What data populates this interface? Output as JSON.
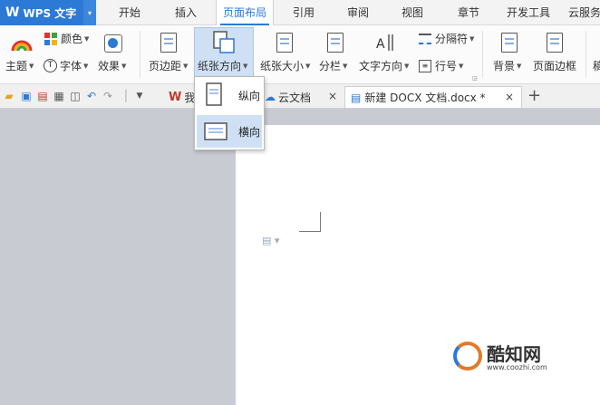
{
  "app": {
    "logo": "W",
    "name": "WPS 文字",
    "dropdown_arrow": "▾"
  },
  "menu": {
    "tabs": [
      "开始",
      "插入",
      "页面布局",
      "引用",
      "审阅",
      "视图",
      "章节",
      "开发工具",
      "云服务"
    ],
    "active": "页面布局"
  },
  "ribbon": {
    "theme": "主题",
    "color": "颜色",
    "font": "字体",
    "effect": "效果",
    "margins": "页边距",
    "orientation": "纸张方向",
    "size": "纸张大小",
    "columns": "分栏",
    "text_direction": "文字方向",
    "breaks": "分隔符",
    "line_number": "行号",
    "background": "背景",
    "page_border": "页面边框",
    "cut_off": "稿"
  },
  "orientation_menu": {
    "portrait": "纵向",
    "landscape": "横向",
    "selected": "横向"
  },
  "doc_tabs": [
    {
      "label": "我",
      "active": false
    },
    {
      "label": "云文档",
      "active": false
    },
    {
      "label": "新建 DOCX 文档.docx *",
      "active": true
    }
  ],
  "new_tab": "+",
  "close_glyph": "×",
  "watermark": {
    "name": "酷知网",
    "url": "www.coozhi.com"
  },
  "colors": {
    "accent": "#2c79d6",
    "highlight": "#cfe0f5",
    "doc_bg": "#c8ccd2"
  }
}
